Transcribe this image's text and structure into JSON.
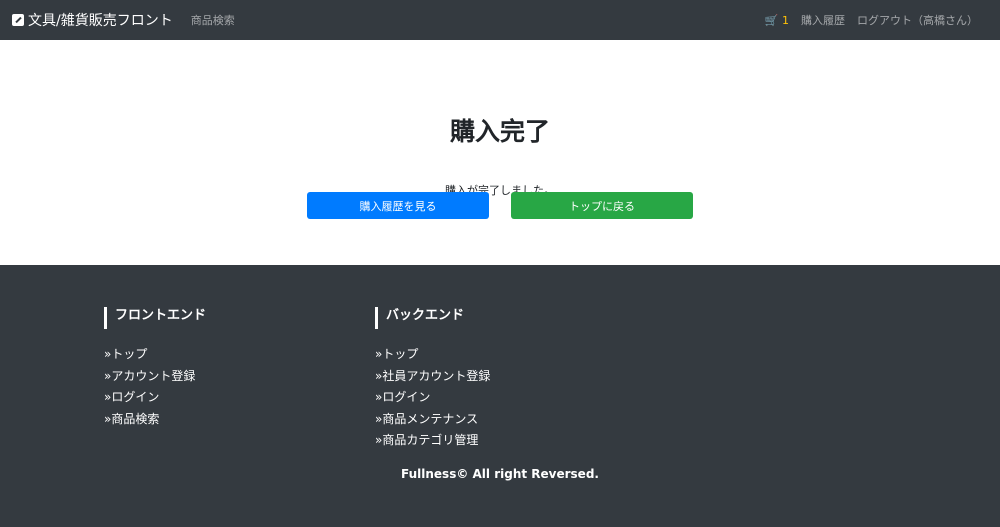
{
  "nav": {
    "brand": "文具/雑貨販売フロント",
    "search": "商品検索",
    "cart_count": "1",
    "history": "購入履歴",
    "logout": "ログアウト（高橋さん）"
  },
  "main": {
    "title": "購入完了",
    "message": "購入が完了しました。",
    "history_button": "購入履歴を見る",
    "top_button": "トップに戻る"
  },
  "footer": {
    "front": {
      "title": "フロントエンド",
      "links": [
        "»トップ",
        "»アカウント登録",
        "»ログイン",
        "»商品検索"
      ]
    },
    "back": {
      "title": "バックエンド",
      "links": [
        "»トップ",
        "»社員アカウント登録",
        "»ログイン",
        "»商品メンテナンス",
        "»商品カテゴリ管理"
      ]
    },
    "copyright": "Fullness© All right Reversed."
  }
}
